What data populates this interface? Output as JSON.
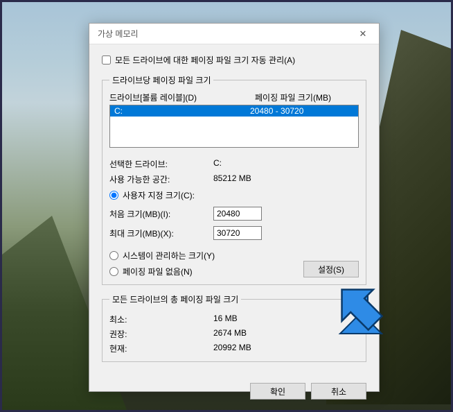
{
  "dialog": {
    "title": "가상 메모리",
    "auto_manage_label": "모든 드라이브에 대한 페이징 파일 크기 자동 관리(A)"
  },
  "group1": {
    "legend": "드라이브당 페이징 파일 크기",
    "header_drive": "드라이브[볼륨 레이블](D)",
    "header_size": "페이징 파일 크기(MB)",
    "rows": [
      {
        "drive": "C:",
        "size": "20480 - 30720"
      }
    ],
    "selected_drive_label": "선택한 드라이브:",
    "selected_drive_value": "C:",
    "available_label": "사용 가능한 공간:",
    "available_value": "85212 MB",
    "radio_custom": "사용자 지정 크기(C):",
    "initial_label": "처음 크기(MB)(I):",
    "initial_value": "20480",
    "max_label": "최대 크기(MB)(X):",
    "max_value": "30720",
    "radio_system": "시스템이 관리하는 크기(Y)",
    "radio_none": "페이징 파일 없음(N)",
    "set_button": "설정(S)"
  },
  "group2": {
    "legend": "모든 드라이브의 총 페이징 파일 크기",
    "min_label": "최소:",
    "min_value": "16 MB",
    "rec_label": "권장:",
    "rec_value": "2674 MB",
    "cur_label": "현재:",
    "cur_value": "20992 MB"
  },
  "buttons": {
    "ok": "확인",
    "cancel": "취소"
  }
}
